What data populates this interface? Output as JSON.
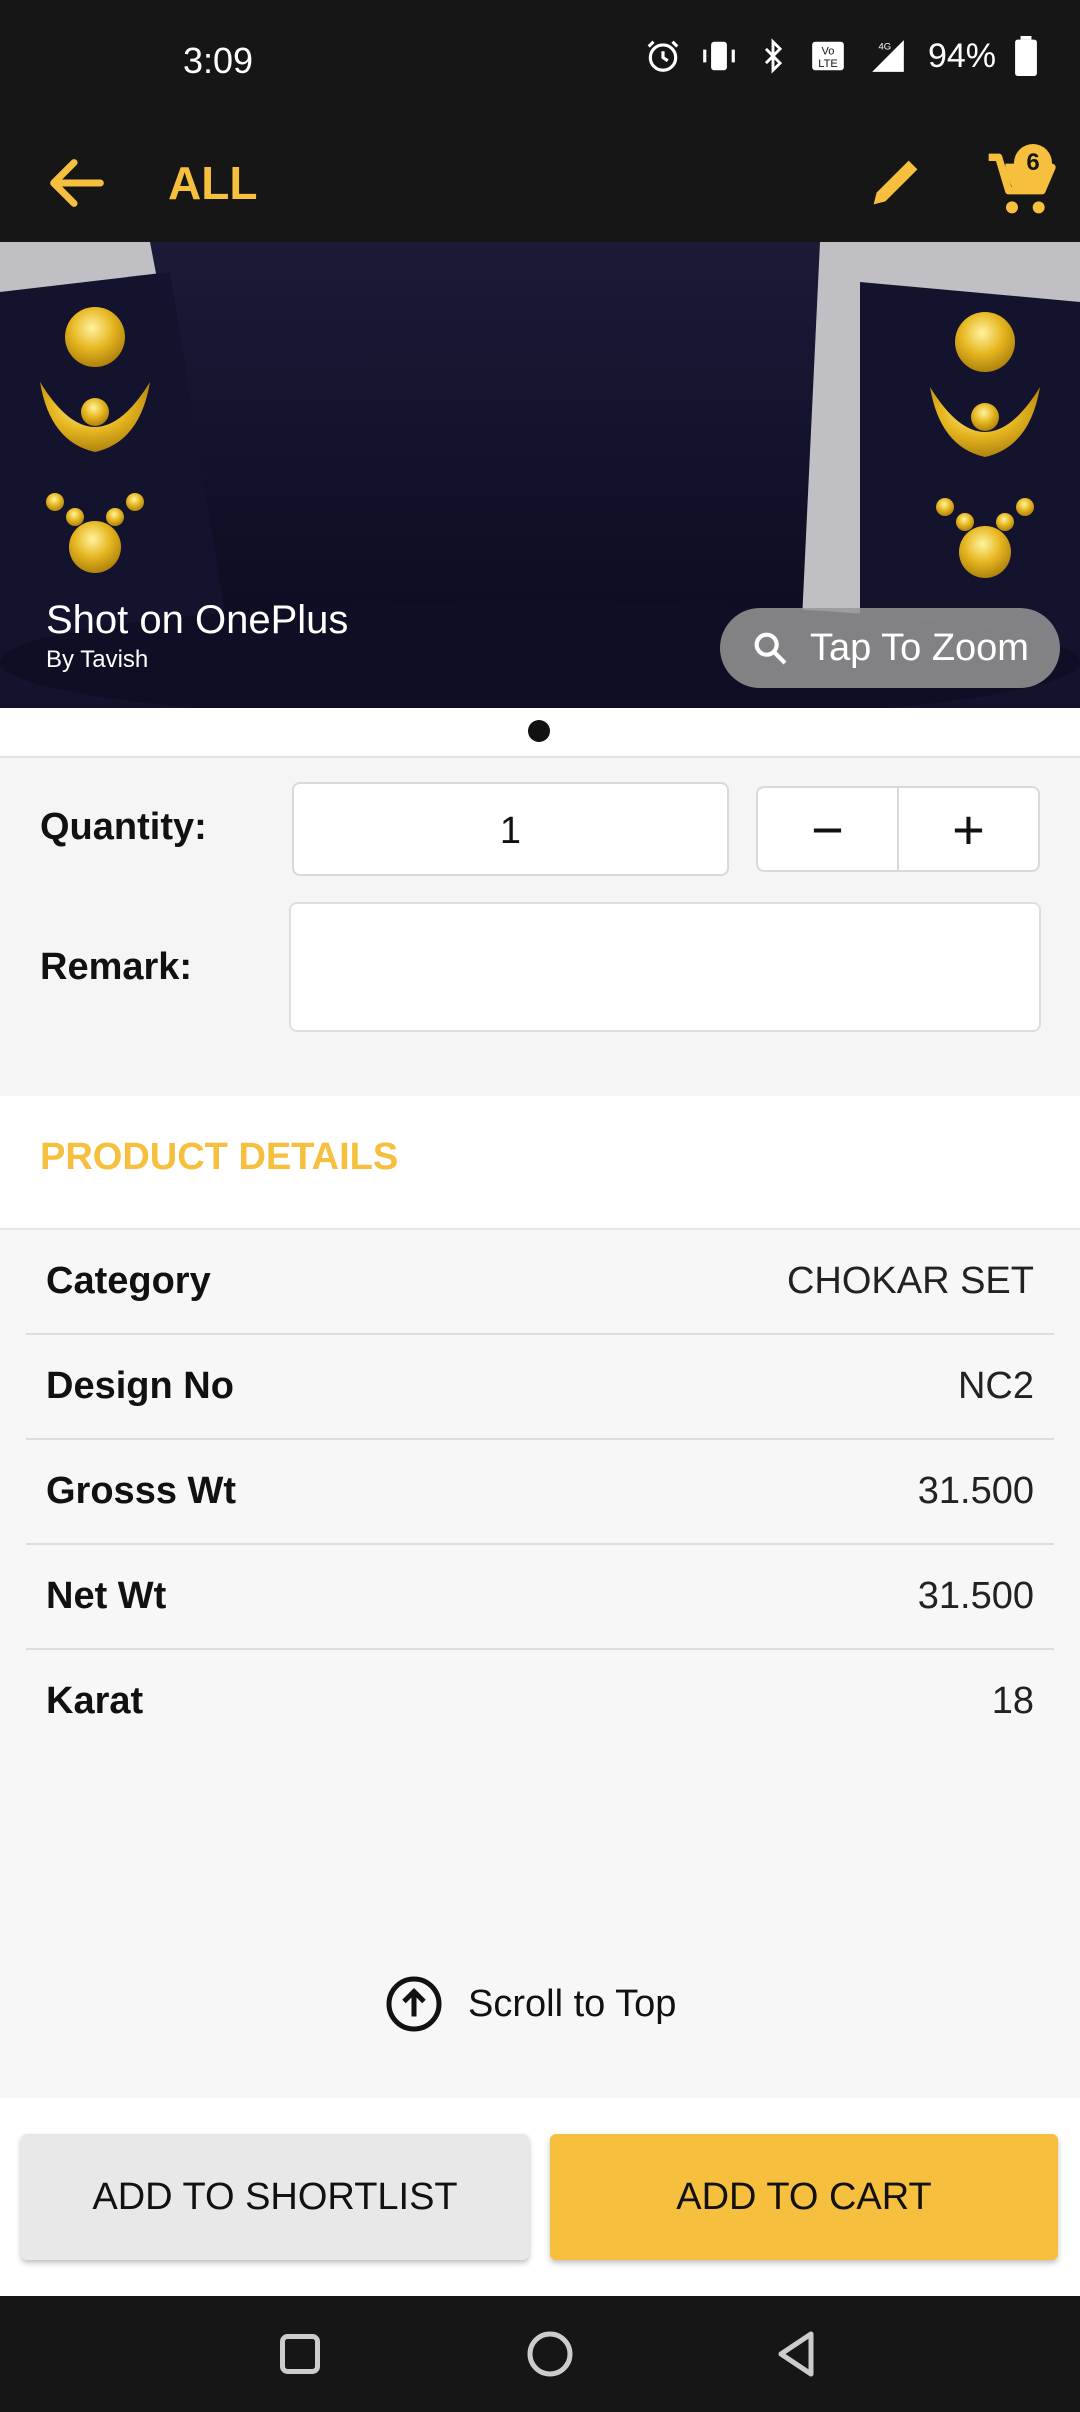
{
  "status_bar": {
    "time": "3:09",
    "battery": "94%",
    "icons": [
      "alarm-icon",
      "vibrate-icon",
      "bluetooth-icon",
      "volte-icon",
      "signal-4g-icon",
      "battery-icon"
    ]
  },
  "app_bar": {
    "title": "ALL",
    "cart_count": "6",
    "accent": "#f6bf3d"
  },
  "hero": {
    "watermark_title": "Shot on OnePlus",
    "watermark_sub": "By Tavish",
    "zoom_label": "Tap To Zoom"
  },
  "form": {
    "quantity_label": "Quantity:",
    "quantity_value": "1",
    "minus": "−",
    "plus": "+",
    "remark_label": "Remark:",
    "remark_value": ""
  },
  "product_details": {
    "header": "PRODUCT DETAILS",
    "rows": [
      {
        "key": "Category",
        "value": "CHOKAR SET"
      },
      {
        "key": "Design No",
        "value": "NC2"
      },
      {
        "key": "Grosss Wt",
        "value": "31.500"
      },
      {
        "key": "Net Wt",
        "value": "31.500"
      },
      {
        "key": "Karat",
        "value": "18"
      }
    ]
  },
  "scroll_top": {
    "label": "Scroll to Top"
  },
  "actions": {
    "shortlist": "ADD TO SHORTLIST",
    "cart": "ADD TO CART"
  }
}
